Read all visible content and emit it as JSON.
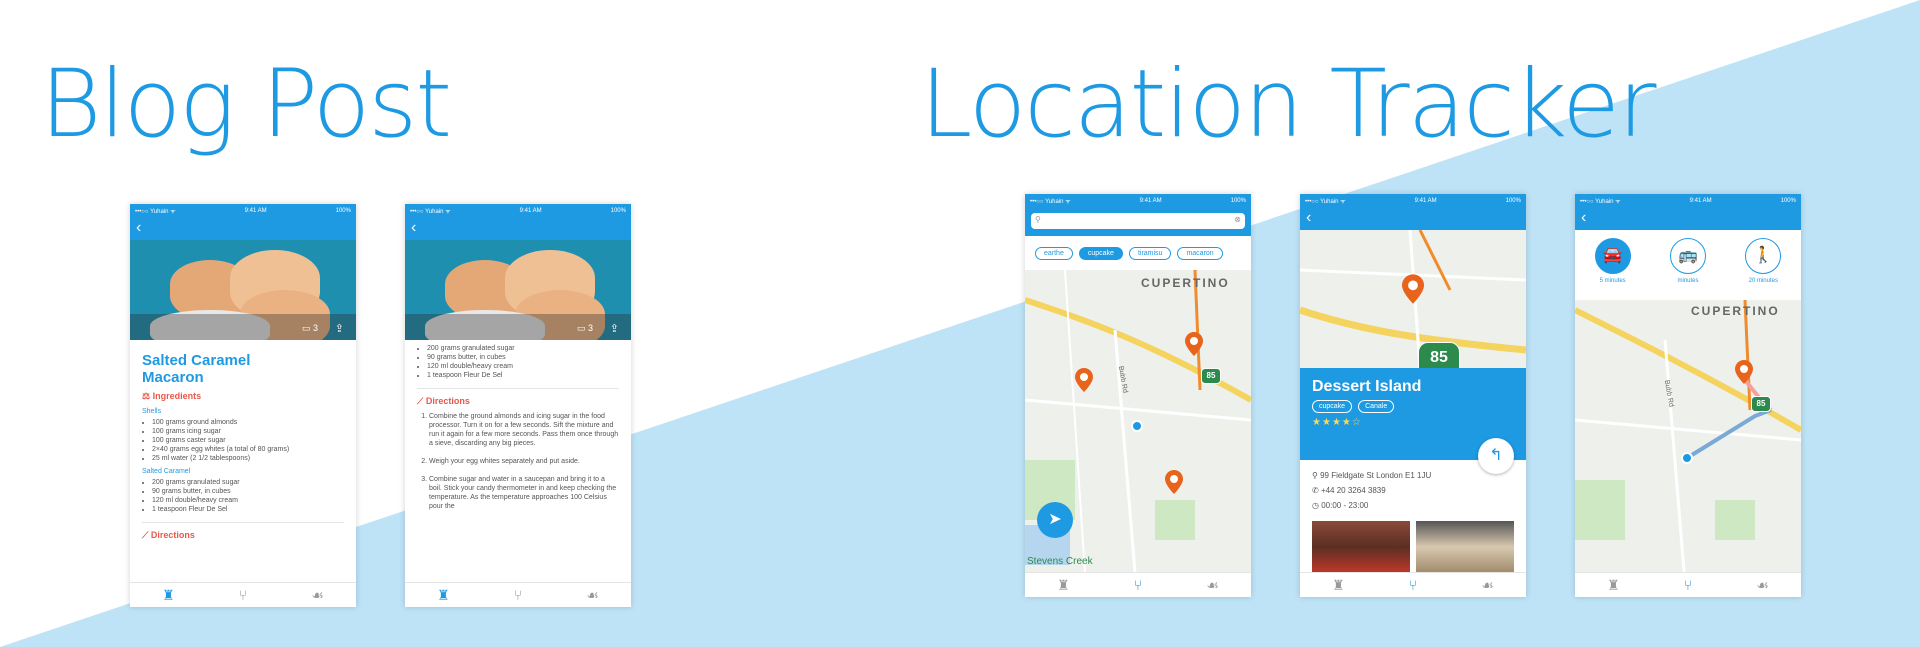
{
  "titles": {
    "blog": "Blog Post",
    "location": "Location Tracker"
  },
  "colors": {
    "accent": "#1e9ae3",
    "section": "#e8584c",
    "background_wedge": "#bee3f7",
    "pin": "#e8631c",
    "highway": "#2c8a4c"
  },
  "status_bar": {
    "carrier": "•••○○ Yuhain ᯤ",
    "time": "9:41 AM",
    "battery": "100%"
  },
  "tab_icons": [
    "chef-hat-icon",
    "fork-knife-icon",
    "chicken-leg-icon"
  ],
  "blog_post_1": {
    "comment_count": "3",
    "title_line1": "Salted Caramel",
    "title_line2": "Macaron",
    "ingredients_heading": "Ingredients",
    "shells_heading": "Shells",
    "shells": [
      "100 grams ground almonds",
      "100 grams icing sugar",
      "100 grams caster sugar",
      "2×40 grams egg whites (a total of 80 grams)",
      "25 ml water (2 1/2 tablespoons)"
    ],
    "caramel_heading": "Salted Caramel",
    "caramel": [
      "200 grams granulated sugar",
      "90 grams butter, in cubes",
      "120 ml double/heavy cream",
      "1 teaspoon Fleur De Sel"
    ],
    "directions_heading": "Directions"
  },
  "blog_post_2": {
    "comment_count": "3",
    "caramel": [
      "200 grams granulated sugar",
      "90 grams butter, in cubes",
      "120 ml double/heavy cream",
      "1 teaspoon Fleur De Sel"
    ],
    "directions_heading": "Directions",
    "directions": [
      "Combine the ground almonds and icing sugar in the food processor. Turn it on for a few seconds. Sift the mixture and run it again for a few more seconds. Pass them once through a sieve, discarding any big pieces.",
      "Weigh your egg whites separately and put aside.",
      "Combine sugar and water in a saucepan and bring it to a boil. Stick your candy thermometer in and keep checking the temperature. As the temperature approaches 100 Celsius pour the"
    ]
  },
  "map_search": {
    "chips": [
      "earthe",
      "cupcake",
      "tiramisu",
      "macaron"
    ],
    "selected_chip": 1,
    "city": "CUPERTINO",
    "road": "Bubb Rd",
    "highway": "85",
    "place": "Stevens Creek"
  },
  "place_detail": {
    "name": "Dessert Island",
    "tags": [
      "cupcake",
      "Canale"
    ],
    "rating": 4,
    "address": "99 Fieldgate St London E1 1JU",
    "phone": "+44 20 3264 3839",
    "hours": "00:00 - 23:00",
    "highway": "85"
  },
  "directions_map": {
    "modes": [
      {
        "icon": "car-icon",
        "label": "5 minutes"
      },
      {
        "icon": "bus-icon",
        "label": "minutes"
      },
      {
        "icon": "walking-icon",
        "label": "20 minutes"
      }
    ],
    "city": "CUPERTINO",
    "road": "Bubb Rd",
    "highway": "85"
  }
}
